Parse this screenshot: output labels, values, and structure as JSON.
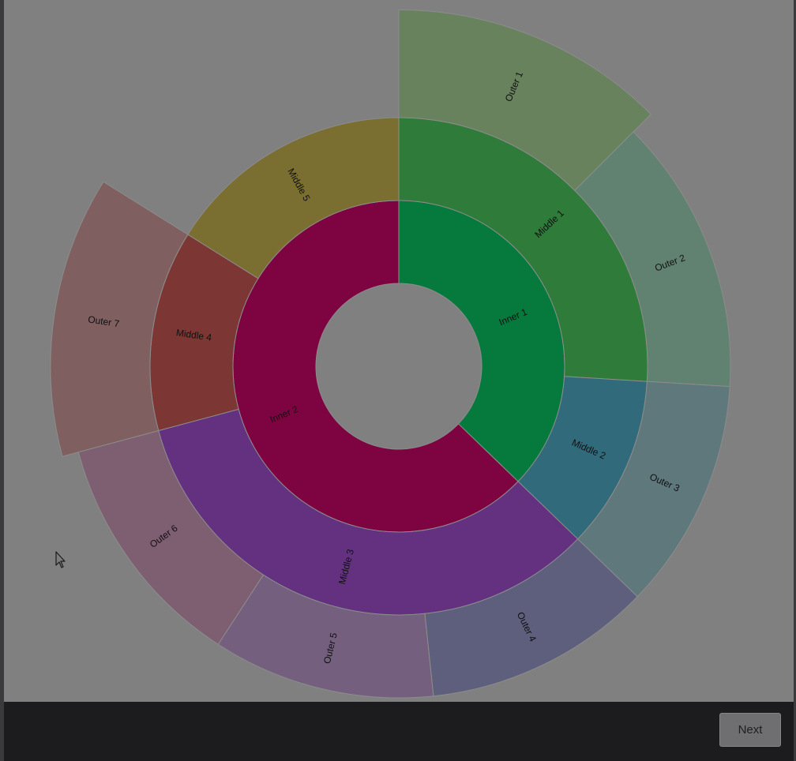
{
  "footer": {
    "next_label": "Next"
  },
  "chart_data": {
    "type": "sunburst",
    "rings": [
      "inner",
      "middle",
      "outer"
    ],
    "segments": [
      {
        "ring": "inner",
        "label": "Inner 1",
        "start_deg": 0,
        "end_deg": 134,
        "color": "#067a3c",
        "label_color": "#111111"
      },
      {
        "ring": "inner",
        "label": "Inner 2",
        "start_deg": 134,
        "end_deg": 360,
        "color": "#7e0441",
        "label_color": "#e6c8d8"
      },
      {
        "ring": "middle",
        "label": "Middle 1",
        "start_deg": 0,
        "end_deg": 93.5,
        "color": "#2e7b3a",
        "label_color": "#111111"
      },
      {
        "ring": "middle",
        "label": "Middle 2",
        "start_deg": 93.5,
        "end_deg": 134,
        "color": "#316a7a",
        "label_color": "#111111"
      },
      {
        "ring": "middle",
        "label": "Middle 3",
        "start_deg": 134,
        "end_deg": 255,
        "color": "#633180",
        "label_color": "#111111"
      },
      {
        "ring": "middle",
        "label": "Middle 4",
        "start_deg": 255,
        "end_deg": 302,
        "color": "#7c3633",
        "label_color": "#111111"
      },
      {
        "ring": "middle",
        "label": "Middle 5",
        "start_deg": 302,
        "end_deg": 360,
        "color": "#7b6e31",
        "label_color": "#111111"
      },
      {
        "ring": "outer",
        "label": "Outer 1",
        "start_deg": 0,
        "end_deg": 45,
        "color": "#68825e",
        "label_color": "#111111",
        "depth": 1.3
      },
      {
        "ring": "outer",
        "label": "Outer 2",
        "start_deg": 45,
        "end_deg": 93.5,
        "color": "#628271",
        "label_color": "#111111",
        "depth": 1.0
      },
      {
        "ring": "outer",
        "label": "Outer 3",
        "start_deg": 93.5,
        "end_deg": 134,
        "color": "#5f787c",
        "label_color": "#111111",
        "depth": 1.0
      },
      {
        "ring": "outer",
        "label": "Outer 4",
        "start_deg": 134,
        "end_deg": 174,
        "color": "#5d5f7d",
        "label_color": "#111111",
        "depth": 1.0
      },
      {
        "ring": "outer",
        "label": "Outer 5",
        "start_deg": 174,
        "end_deg": 213,
        "color": "#745f7f",
        "label_color": "#111111",
        "depth": 1.0
      },
      {
        "ring": "outer",
        "label": "Outer 6",
        "start_deg": 213,
        "end_deg": 255,
        "color": "#7e5e71",
        "label_color": "#111111",
        "depth": 1.0
      },
      {
        "ring": "outer",
        "label": "Outer 7",
        "start_deg": 255,
        "end_deg": 302,
        "color": "#7f5f5f",
        "label_color": "#111111",
        "depth": 1.2
      }
    ]
  }
}
